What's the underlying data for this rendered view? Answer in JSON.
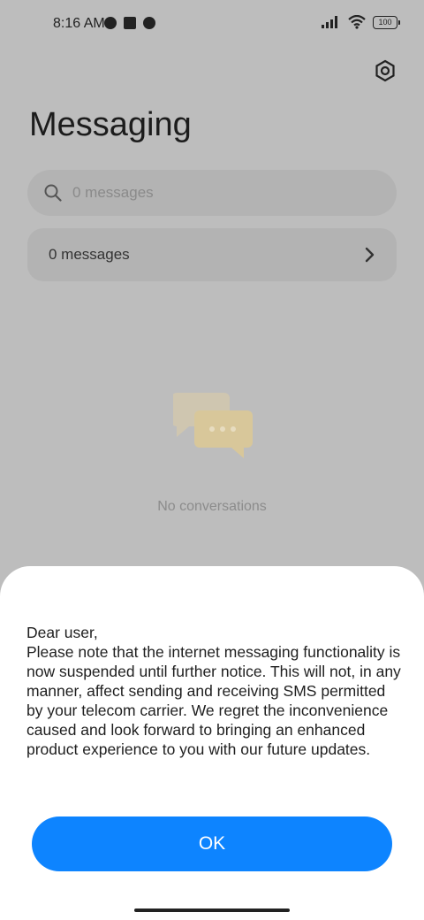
{
  "status_bar": {
    "time": "8:16 AM",
    "battery": "100"
  },
  "header": {
    "title": "Messaging",
    "settings_icon": "settings-hexagon-icon"
  },
  "search": {
    "placeholder": "0 messages",
    "icon": "search-icon"
  },
  "messages_row": {
    "label": "0 messages",
    "icon": "chevron-right-icon"
  },
  "empty_state": {
    "text": "No conversations",
    "icon": "chat-bubbles-icon"
  },
  "dialog": {
    "greeting": "Dear user,",
    "body": "Please note that the internet messaging functionality is now suspended until further notice. This will not, in any manner, affect sending and receiving SMS permitted by your telecom carrier. We regret the inconvenience caused and look forward to bringing an enhanced product experience to you with our future updates.",
    "ok_label": "OK",
    "accent": "#0d84ff"
  },
  "colors": {
    "scrim_background": "#bdbdbd",
    "illustration": "#e9d7a8"
  }
}
